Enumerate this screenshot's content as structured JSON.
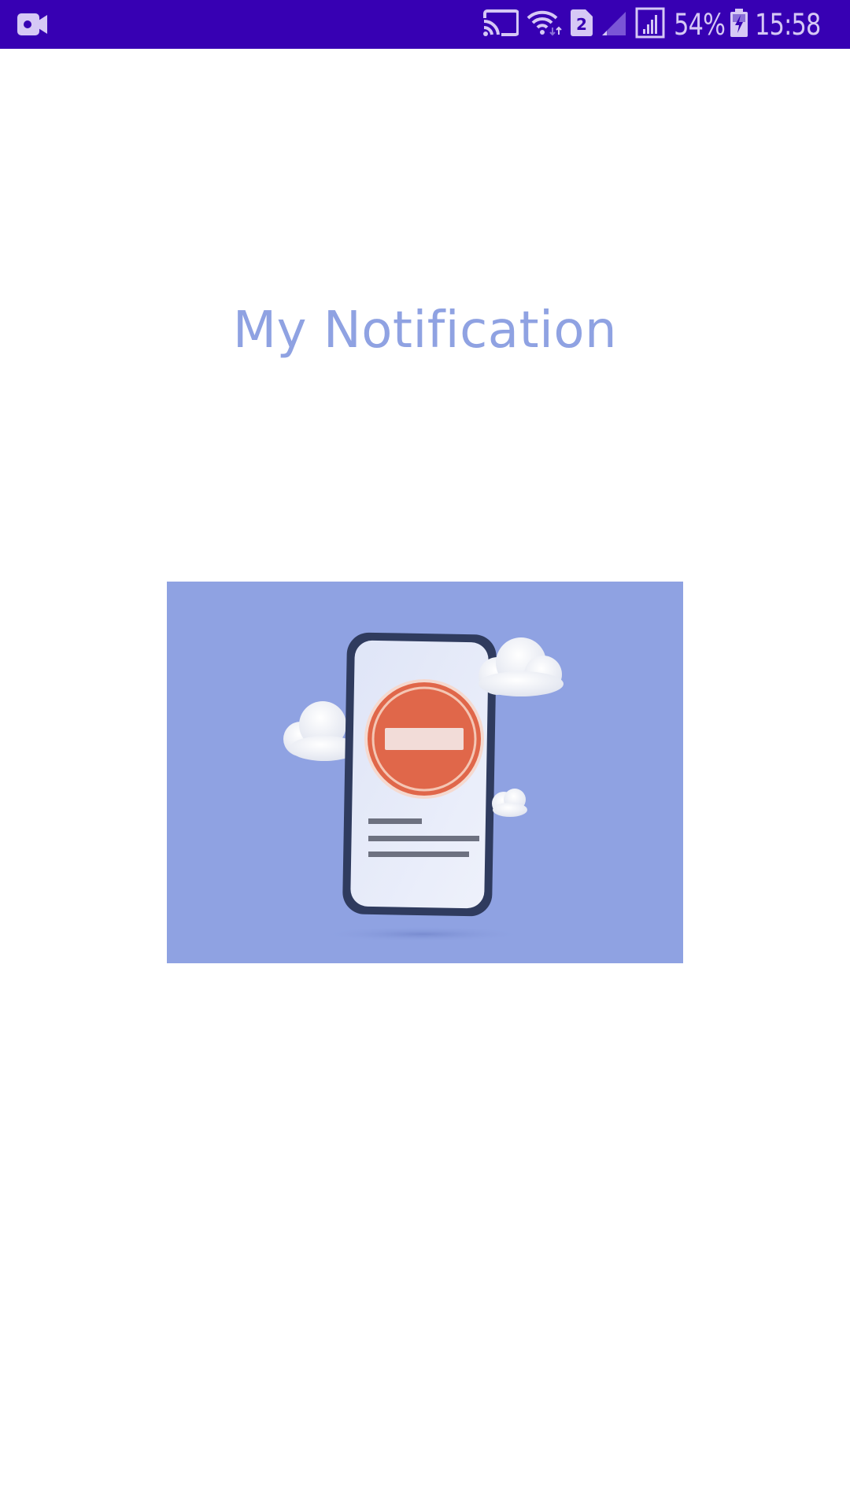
{
  "status_bar": {
    "background_color": "#3700b3",
    "left_icons": [
      "screen-record-icon"
    ],
    "right_icons": [
      "cast-icon",
      "wifi-icon",
      "sim2-icon",
      "signal-sim1-icon",
      "signal-sim2-icon",
      "battery-charging-icon"
    ],
    "sim_badge": "2",
    "battery_percent": "54%",
    "time": "15:58"
  },
  "main": {
    "title": "My Notification",
    "title_color": "#8fa2e2",
    "illustration": {
      "description": "Phone with a no-entry sign and clouds",
      "background_color": "#8fa2e2",
      "sign_color": "#e0674a"
    }
  }
}
